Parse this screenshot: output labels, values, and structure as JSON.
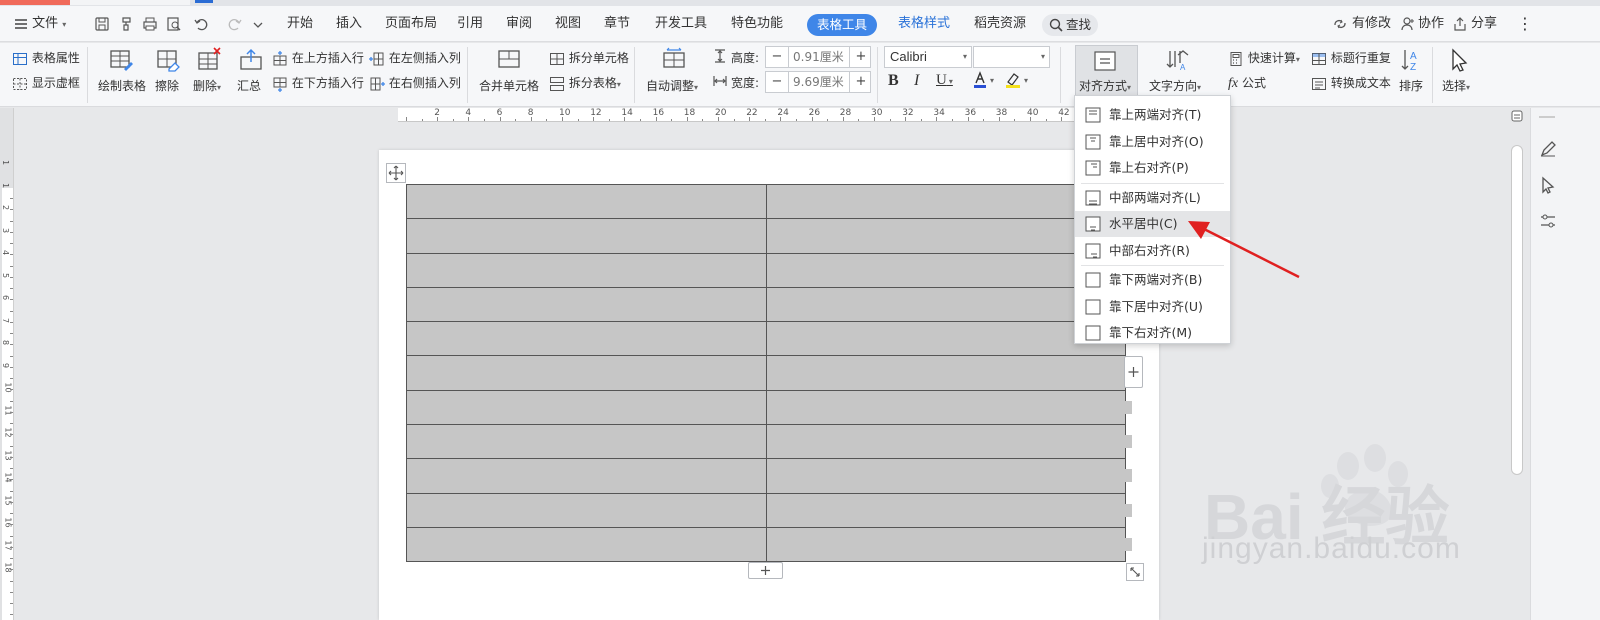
{
  "menubar": {
    "file_label": "文件",
    "tabs": [
      "开始",
      "插入",
      "页面布局",
      "引用",
      "审阅",
      "视图",
      "章节",
      "开发工具",
      "特色功能",
      "表格工具",
      "表格样式",
      "稻壳资源"
    ],
    "search_label": "查找",
    "right": {
      "modified": "有修改",
      "collab": "协作",
      "share": "分享"
    }
  },
  "ribbon": {
    "table_props": "表格属性",
    "show_grid": "显示虚框",
    "draw_table": "绘制表格",
    "erase": "擦除",
    "delete": "删除",
    "summary": "汇总",
    "insert_above": "在上方插入行",
    "insert_below": "在下方插入行",
    "insert_left": "在左侧插入列",
    "insert_right": "在右侧插入列",
    "merge_cells": "合并单元格",
    "split_cells": "拆分单元格",
    "split_table": "拆分表格",
    "auto_fit": "自动调整",
    "height_label": "高度:",
    "height_value": "0.91厘米",
    "width_label": "宽度:",
    "width_value": "9.69厘米",
    "font_name": "Calibri",
    "font_size": "",
    "align": "对齐方式",
    "text_dir": "文字方向",
    "quick_calc": "快速计算",
    "formula": "公式",
    "repeat_header": "标题行重复",
    "to_text": "转换成文本",
    "sort": "排序",
    "select": "选择"
  },
  "ruler": {
    "h_numbers": [
      "2",
      "4",
      "6",
      "8",
      "10",
      "12",
      "14",
      "16",
      "18",
      "20",
      "22",
      "24",
      "26",
      "28",
      "30",
      "32",
      "34",
      "36",
      "38",
      "40",
      "42"
    ],
    "v_numbers": [
      "1",
      "1",
      "2",
      "3",
      "4",
      "5",
      "6",
      "7",
      "8",
      "9",
      "10",
      "11",
      "12",
      "13",
      "14",
      "15",
      "16",
      "17",
      "18"
    ]
  },
  "table": {
    "rows": 11,
    "cols": 2
  },
  "dropdown": {
    "items": [
      {
        "label": "靠上两端对齐(T)",
        "icon": "align-top-justify-icon"
      },
      {
        "label": "靠上居中对齐(O)",
        "icon": "align-top-center-icon"
      },
      {
        "label": "靠上右对齐(P)",
        "icon": "align-top-right-icon"
      },
      {
        "label": "中部两端对齐(L)",
        "icon": "align-middle-justify-icon"
      },
      {
        "label": "水平居中(C)",
        "icon": "align-middle-center-icon",
        "highlighted": true
      },
      {
        "label": "中部右对齐(R)",
        "icon": "align-middle-right-icon"
      },
      {
        "label": "靠下两端对齐(B)",
        "icon": "align-bottom-justify-icon"
      },
      {
        "label": "靠下居中对齐(U)",
        "icon": "align-bottom-center-icon"
      },
      {
        "label": "靠下右对齐(M)",
        "icon": "align-bottom-right-icon"
      }
    ]
  },
  "watermark": {
    "text": "Bai 经验",
    "url": "jingyan.baidu.com"
  },
  "colors": {
    "accent": "#3f86e8",
    "arrow": "#e02020",
    "table_fill": "#c6c6c6"
  }
}
